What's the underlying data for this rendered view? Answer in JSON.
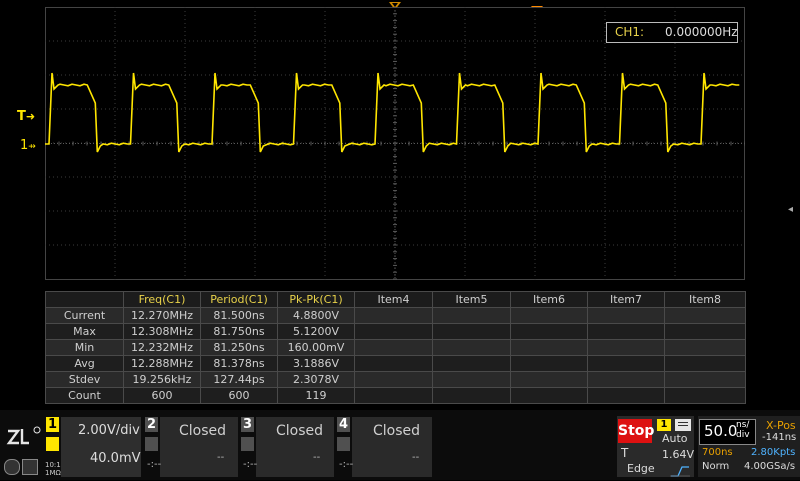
{
  "colors": {
    "ch1": "#ffe600",
    "grid": "#3c3c3c",
    "grid_dot": "#5a5a5a",
    "stop": "#dd1111",
    "timebase_highlight": "#d08a00",
    "sample": "#4fb3ff"
  },
  "screen": {
    "left_markers": {
      "trigger_label": "T",
      "channel_label": "1"
    },
    "freq_counter": {
      "label": "CH1:",
      "value": "0.000000Hz"
    }
  },
  "measurements": {
    "headers": [
      "",
      "Freq(C1)",
      "Period(C1)",
      "Pk-Pk(C1)",
      "Item4",
      "Item5",
      "Item6",
      "Item7",
      "Item8"
    ],
    "rows": [
      {
        "label": "Current",
        "values": [
          "12.270MHz",
          "81.500ns",
          "4.8800V"
        ]
      },
      {
        "label": "Max",
        "values": [
          "12.308MHz",
          "81.750ns",
          "5.1200V"
        ]
      },
      {
        "label": "Min",
        "values": [
          "12.232MHz",
          "81.250ns",
          "160.00mV"
        ]
      },
      {
        "label": "Avg",
        "values": [
          "12.288MHz",
          "81.378ns",
          "3.1886V"
        ]
      },
      {
        "label": "Stdev",
        "values": [
          "19.256kHz",
          "127.44ps",
          "2.3078V"
        ]
      },
      {
        "label": "Count",
        "values": [
          "600",
          "600",
          "119"
        ]
      }
    ]
  },
  "channels": {
    "ch1": {
      "num": "1",
      "scale": "2.00V/div",
      "offset": "40.0mV",
      "coupling_label": "1MΩ",
      "bw": "10:1"
    },
    "ch2": {
      "num": "2",
      "state": "Closed",
      "left": "-:--",
      "right": "--"
    },
    "ch3": {
      "num": "3",
      "state": "Closed",
      "left": "-:--",
      "right": "--"
    },
    "ch4": {
      "num": "4",
      "state": "Closed",
      "left": "-:--",
      "right": "--"
    }
  },
  "trigger": {
    "run_state": "Stop",
    "source": "1",
    "mode": "Auto",
    "type_label": "T",
    "level": "1.64V",
    "slope": "Edge"
  },
  "timebase": {
    "scale_value": "50.0",
    "scale_unit_top": "ns/",
    "scale_unit_bottom": "div",
    "xpos_label": "X-Pos",
    "xpos_value": "-141ns",
    "window": "700ns",
    "memory": "2.80Kpts",
    "acq_mode": "Norm",
    "sample_rate": "4.00GSa/s"
  },
  "brand": {
    "logo": "ZLG"
  }
}
